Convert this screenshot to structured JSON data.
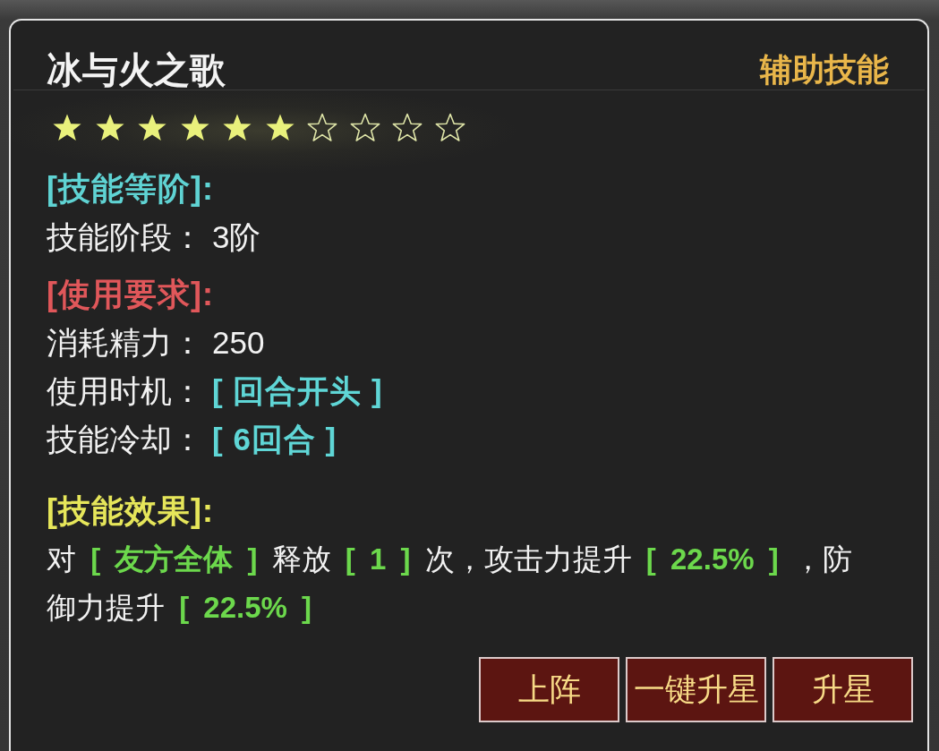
{
  "title": "冰与火之歌",
  "skill_type": "辅助技能",
  "stars": 6,
  "sections": [
    {
      "kind": "rows",
      "heading": "[技能等阶]:",
      "color": "#5fd3d3",
      "rows": [
        {
          "label": "技能阶段：",
          "value": "3阶",
          "kind": "plain"
        }
      ]
    },
    {
      "kind": "rows",
      "heading": "[使用要求]:",
      "color": "#e0575a",
      "rows": [
        {
          "label": "消耗精力：",
          "value": "250",
          "kind": "plain"
        },
        {
          "label": "使用时机：",
          "value": "[ 回合开头 ]",
          "kind": "tag"
        },
        {
          "label": "技能冷却：",
          "value": "[ 6回合 ]",
          "kind": "tag"
        }
      ]
    },
    {
      "kind": "paragraph",
      "heading": "[技能效果]:",
      "color": "#e6e65a",
      "segments": [
        {
          "text": "对 ",
          "kind": "plain"
        },
        {
          "text": "[ 友方全体 ]",
          "kind": "tag"
        },
        {
          "text": " 释放 ",
          "kind": "plain"
        },
        {
          "text": "[ 1 ]",
          "kind": "tag"
        },
        {
          "text": " 次，攻击力提升 ",
          "kind": "plain"
        },
        {
          "text": "[ 22.5% ]",
          "kind": "tag"
        },
        {
          "text": " ，防御力提升 ",
          "kind": "plain"
        },
        {
          "text": "[ 22.5% ]",
          "kind": "tag"
        }
      ]
    }
  ],
  "buttons": [
    "上阵",
    "一键升星",
    "升星"
  ]
}
